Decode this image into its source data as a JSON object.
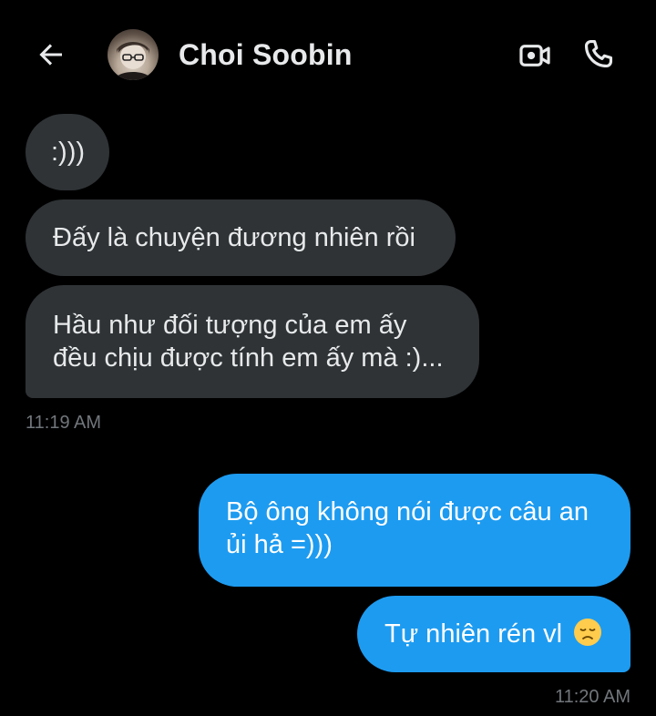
{
  "header": {
    "contact_name": "Choi Soobin",
    "icons": {
      "back": "arrow-left-icon",
      "video": "video-camera-icon",
      "call": "phone-icon"
    }
  },
  "messages": [
    {
      "direction": "incoming",
      "lines": [
        ":)))"
      ]
    },
    {
      "direction": "incoming",
      "lines": [
        "Đấy là chuyện đương nhiên rồi"
      ]
    },
    {
      "direction": "incoming",
      "lines": [
        "Hầu như đối tượng của em ấy",
        "đều chịu được tính em ấy mà :)..."
      ]
    },
    {
      "direction": "outgoing",
      "lines": [
        "Bộ ông không nói được câu an",
        "ủi hả =)))"
      ]
    },
    {
      "direction": "outgoing",
      "lines": [
        "Tự nhiên rén vl"
      ],
      "emoji": "disappointed-face-emoji"
    }
  ],
  "timestamps": {
    "incoming_group": "11:19 AM",
    "outgoing_group": "11:20 AM"
  },
  "colors": {
    "background": "#000000",
    "incoming_bubble": "#2f3336",
    "outgoing_bubble": "#1d9bf0",
    "text_primary": "#e7e9ea",
    "text_secondary": "#71767b"
  }
}
